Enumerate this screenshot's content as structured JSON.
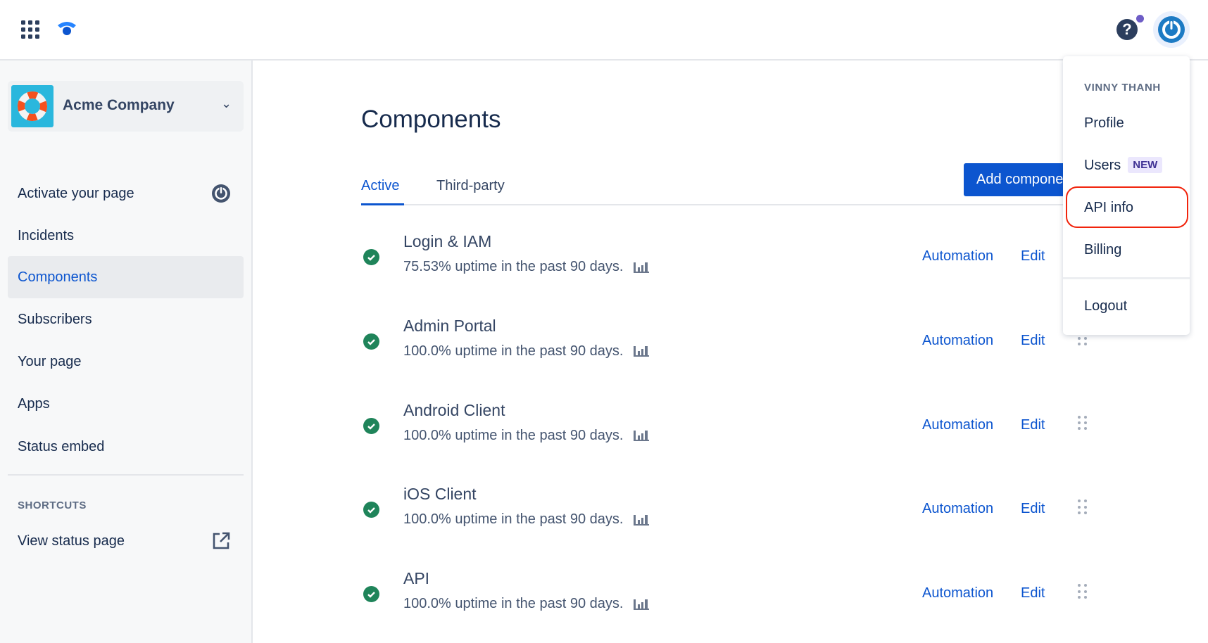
{
  "topbar": {
    "apps_icon": "grid-icon",
    "logo_icon": "statuspage-logo",
    "help_icon": "question-icon",
    "avatar_icon": "power-icon"
  },
  "sidebar": {
    "company": "Acme Company",
    "items": [
      {
        "label": "Activate your page",
        "icon": "power-icon"
      },
      {
        "label": "Incidents"
      },
      {
        "label": "Components",
        "active": true
      },
      {
        "label": "Subscribers"
      },
      {
        "label": "Your page"
      },
      {
        "label": "Apps"
      },
      {
        "label": "Status embed"
      }
    ],
    "shortcuts_heading": "SHORTCUTS",
    "shortcut": {
      "label": "View status page",
      "icon": "external-link-icon"
    }
  },
  "main": {
    "title": "Components",
    "tabs": [
      {
        "label": "Active",
        "active": true
      },
      {
        "label": "Third-party"
      }
    ],
    "add_button": "Add component",
    "components": [
      {
        "name": "Login & IAM",
        "uptime": "75.53% uptime in the past 90 days."
      },
      {
        "name": "Admin Portal",
        "uptime": "100.0% uptime in the past 90 days."
      },
      {
        "name": "Android Client",
        "uptime": "100.0% uptime in the past 90 days."
      },
      {
        "name": "iOS Client",
        "uptime": "100.0% uptime in the past 90 days."
      },
      {
        "name": "API",
        "uptime": "100.0% uptime in the past 90 days."
      }
    ],
    "automation_label": "Automation",
    "edit_label": "Edit"
  },
  "user_menu": {
    "user": "VINNY THANH",
    "items": [
      "Profile",
      "Users",
      "API info",
      "Billing",
      "Logout"
    ],
    "new_badge": "NEW",
    "highlight_color": "#f1240c"
  },
  "colors": {
    "accent": "#0c55cf",
    "success": "#1f845a"
  }
}
